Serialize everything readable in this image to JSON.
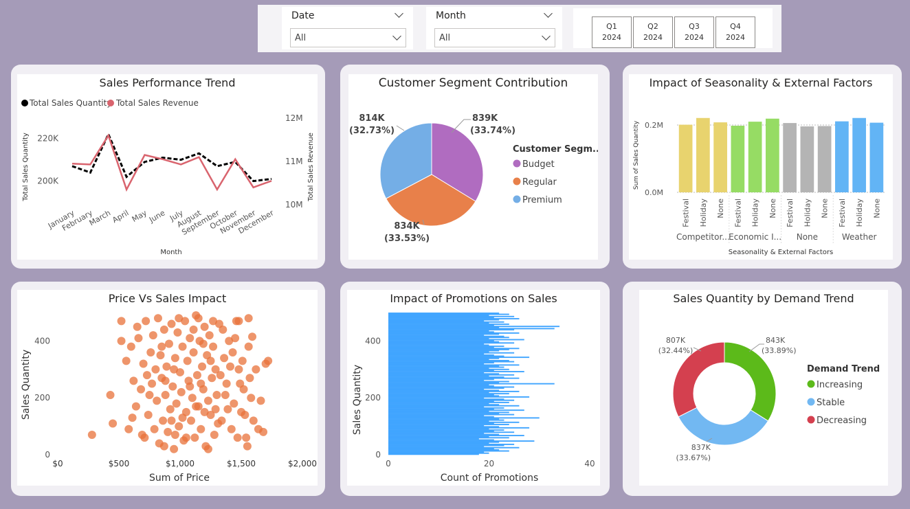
{
  "slicers": {
    "date": {
      "label": "Date",
      "value": "All"
    },
    "month": {
      "label": "Month",
      "value": "All"
    },
    "quarters": [
      {
        "q": "Q1",
        "year": "2024"
      },
      {
        "q": "Q2",
        "year": "2024"
      },
      {
        "q": "Q3",
        "year": "2024"
      },
      {
        "q": "Q4",
        "year": "2024"
      }
    ]
  },
  "colors": {
    "background": "#a59bb8",
    "line_quantity": "#000000",
    "line_revenue": "#d9646e",
    "budget": "#b06cc0",
    "regular": "#e8804a",
    "premium": "#74aee6",
    "scatter": "#e8723a",
    "bars": "#41a5ff",
    "increasing": "#5cba1a",
    "stable": "#72b8f2",
    "decreasing": "#d4404f",
    "seasonality_groups": [
      "#e8d36e",
      "#96dc64",
      "#b4b4b4",
      "#62b4f5"
    ]
  },
  "chart_data": [
    {
      "type": "line",
      "title": "Sales Performance Trend",
      "xlabel": "Month",
      "ylabel": "Total Sales Quantity",
      "y2label": "Total Sales Revenue",
      "legend": [
        "Total Sales Quantity",
        "Total Sales Revenue"
      ],
      "legend_position": "top-left",
      "categories": [
        "January",
        "February",
        "March",
        "April",
        "May",
        "June",
        "July",
        "August",
        "September",
        "October",
        "November",
        "December"
      ],
      "series": [
        {
          "name": "Total Sales Quantity",
          "axis": "left",
          "style": "dashed",
          "values": [
            207000,
            204000,
            222000,
            202000,
            209000,
            211000,
            210000,
            213000,
            207000,
            209000,
            200000,
            201000
          ]
        },
        {
          "name": "Total Sales Revenue",
          "axis": "right",
          "style": "solid",
          "values": [
            10950000,
            10930000,
            11600000,
            10350000,
            11150000,
            11050000,
            10930000,
            11100000,
            10350000,
            11050000,
            10400000,
            10550000
          ]
        }
      ],
      "y_ticks": [
        "200K",
        "220K"
      ],
      "y_tick_values": [
        200000,
        220000
      ],
      "ylim": [
        196000,
        226000
      ],
      "y2_ticks": [
        "10M",
        "11M",
        "12M"
      ],
      "y2_tick_values": [
        10000000,
        11000000,
        12000000
      ],
      "y2lim": [
        10000000,
        12000000
      ],
      "grid": false
    },
    {
      "type": "pie",
      "title": "Customer Segment Contribution",
      "legend_title": "Customer Segm...",
      "legend_position": "right",
      "slices": [
        {
          "name": "Budget",
          "value": 839000,
          "label": "839K",
          "pct": "(33.74%)"
        },
        {
          "name": "Regular",
          "value": 834000,
          "label": "834K",
          "pct": "(33.53%)"
        },
        {
          "name": "Premium",
          "value": 814000,
          "label": "814K",
          "pct": "(32.73%)"
        }
      ]
    },
    {
      "type": "bar",
      "title": "Impact of Seasonality & External Factors",
      "xlabel": "Seasonality & External Factors",
      "ylabel": "Sum of Sales Quantity",
      "y_ticks": [
        "0.0M",
        "0.2M"
      ],
      "y_tick_values": [
        0,
        200000
      ],
      "ylim": [
        0,
        245000
      ],
      "groups": [
        {
          "name": "Competitor...",
          "categories": [
            "Festival",
            "Holiday",
            "None"
          ],
          "values": [
            201000,
            221000,
            208000
          ]
        },
        {
          "name": "Economic I...",
          "categories": [
            "Festival",
            "Holiday",
            "None"
          ],
          "values": [
            198000,
            210000,
            219000
          ]
        },
        {
          "name": "None",
          "categories": [
            "Festival",
            "Holiday",
            "None"
          ],
          "values": [
            206000,
            196000,
            197000
          ]
        },
        {
          "name": "Weather",
          "categories": [
            "Festival",
            "Holiday",
            "None"
          ],
          "values": [
            211000,
            221000,
            207000
          ]
        }
      ],
      "grid": true
    },
    {
      "type": "scatter",
      "title": "Price Vs Sales Impact",
      "xlabel": "Sum of Price",
      "ylabel": "Sales Quantity",
      "x_ticks": [
        "$0",
        "$500",
        "$1,000",
        "$1,500",
        "$2,000"
      ],
      "x_tick_values": [
        0,
        500,
        1000,
        1500,
        2000
      ],
      "xlim": [
        0,
        2000
      ],
      "y_ticks": [
        "0",
        "200",
        "400"
      ],
      "y_tick_values": [
        0,
        200,
        400
      ],
      "ylim": [
        0,
        500
      ],
      "points": [
        [
          280,
          70
        ],
        [
          430,
          210
        ],
        [
          450,
          110
        ],
        [
          520,
          400
        ],
        [
          560,
          330
        ],
        [
          600,
          380
        ],
        [
          620,
          260
        ],
        [
          640,
          170
        ],
        [
          660,
          410
        ],
        [
          680,
          230
        ],
        [
          700,
          320
        ],
        [
          710,
          60
        ],
        [
          720,
          470
        ],
        [
          740,
          140
        ],
        [
          760,
          360
        ],
        [
          770,
          250
        ],
        [
          780,
          420
        ],
        [
          790,
          90
        ],
        [
          800,
          300
        ],
        [
          810,
          190
        ],
        [
          820,
          480
        ],
        [
          830,
          40
        ],
        [
          840,
          350
        ],
        [
          850,
          270
        ],
        [
          860,
          120
        ],
        [
          870,
          440
        ],
        [
          880,
          210
        ],
        [
          890,
          310
        ],
        [
          900,
          80
        ],
        [
          910,
          390
        ],
        [
          920,
          160
        ],
        [
          930,
          460
        ],
        [
          940,
          240
        ],
        [
          950,
          20
        ],
        [
          960,
          340
        ],
        [
          970,
          180
        ],
        [
          980,
          430
        ],
        [
          990,
          100
        ],
        [
          1000,
          290
        ],
        [
          1010,
          220
        ],
        [
          1020,
          380
        ],
        [
          1030,
          50
        ],
        [
          1040,
          470
        ],
        [
          1050,
          150
        ],
        [
          1060,
          330
        ],
        [
          1070,
          260
        ],
        [
          1080,
          410
        ],
        [
          1090,
          120
        ],
        [
          1100,
          200
        ],
        [
          1110,
          360
        ],
        [
          1120,
          60
        ],
        [
          1130,
          490
        ],
        [
          1140,
          280
        ],
        [
          1150,
          170
        ],
        [
          1160,
          400
        ],
        [
          1170,
          90
        ],
        [
          1180,
          310
        ],
        [
          1190,
          230
        ],
        [
          1200,
          450
        ],
        [
          1210,
          30
        ],
        [
          1220,
          350
        ],
        [
          1230,
          190
        ],
        [
          1240,
          420
        ],
        [
          1250,
          140
        ],
        [
          1260,
          270
        ],
        [
          1270,
          380
        ],
        [
          1280,
          70
        ],
        [
          1290,
          300
        ],
        [
          1300,
          210
        ],
        [
          1320,
          460
        ],
        [
          1340,
          120
        ],
        [
          1360,
          340
        ],
        [
          1380,
          250
        ],
        [
          1400,
          400
        ],
        [
          1420,
          90
        ],
        [
          1440,
          180
        ],
        [
          1460,
          470
        ],
        [
          1480,
          300
        ],
        [
          1500,
          150
        ],
        [
          1520,
          230
        ],
        [
          1540,
          60
        ],
        [
          1560,
          380
        ],
        [
          1580,
          200
        ],
        [
          1600,
          120
        ],
        [
          1620,
          300
        ],
        [
          1640,
          90
        ],
        [
          1660,
          190
        ],
        [
          1680,
          80
        ],
        [
          1700,
          320
        ],
        [
          1720,
          330
        ],
        [
          1560,
          480
        ],
        [
          1480,
          470
        ],
        [
          1590,
          415
        ],
        [
          520,
          470
        ],
        [
          580,
          90
        ],
        [
          650,
          450
        ],
        [
          690,
          70
        ],
        [
          730,
          280
        ],
        [
          870,
          30
        ],
        [
          930,
          120
        ],
        [
          990,
          480
        ],
        [
          1050,
          60
        ],
        [
          1110,
          440
        ],
        [
          1170,
          250
        ],
        [
          1230,
          20
        ],
        [
          1290,
          160
        ],
        [
          1350,
          440
        ],
        [
          1410,
          310
        ],
        [
          1470,
          60
        ],
        [
          1530,
          140
        ],
        [
          750,
          210
        ],
        [
          850,
          380
        ],
        [
          950,
          300
        ],
        [
          1020,
          130
        ],
        [
          1130,
          170
        ],
        [
          1190,
          390
        ],
        [
          1250,
          330
        ],
        [
          1310,
          110
        ],
        [
          1370,
          210
        ],
        [
          1430,
          360
        ],
        [
          1490,
          250
        ],
        [
          1550,
          30
        ],
        [
          610,
          130
        ],
        [
          880,
          260
        ],
        [
          960,
          70
        ],
        [
          1080,
          240
        ],
        [
          1150,
          480
        ],
        [
          1200,
          150
        ],
        [
          1270,
          470
        ],
        [
          1330,
          280
        ],
        [
          1390,
          160
        ],
        [
          1450,
          410
        ],
        [
          1510,
          330
        ],
        [
          1570,
          270
        ]
      ]
    },
    {
      "type": "bar",
      "orientation": "horizontal",
      "title": "Impact of Promotions on Sales",
      "xlabel": "Count of Promotions",
      "ylabel": "Sales Quantity",
      "x_ticks": [
        "0",
        "20",
        "40"
      ],
      "x_tick_values": [
        0,
        20,
        40
      ],
      "xlim": [
        0,
        40
      ],
      "y_ticks": [
        "0",
        "200",
        "400"
      ],
      "y_tick_values": [
        0,
        200,
        400
      ],
      "ylim": [
        0,
        500
      ],
      "values": [
        18,
        20,
        19,
        24,
        22,
        21,
        26,
        19,
        23,
        25,
        20,
        22,
        29,
        21,
        18,
        24,
        20,
        27,
        22,
        19,
        25,
        21,
        23,
        20,
        28,
        22,
        19,
        24,
        21,
        26,
        20,
        23,
        22,
        30,
        21,
        19,
        25,
        22,
        24,
        20,
        27,
        21,
        23,
        19,
        26,
        22,
        20,
        24,
        21,
        25,
        23,
        19,
        28,
        22,
        21,
        24,
        20,
        26,
        22,
        19,
        23,
        25,
        21,
        20,
        33,
        22,
        24,
        19,
        21,
        26,
        23,
        20,
        25,
        22,
        19,
        27,
        21,
        24,
        20,
        23,
        22,
        26,
        19,
        21,
        25,
        24,
        20,
        22,
        28,
        23,
        21,
        19,
        25,
        20,
        22,
        24,
        26,
        21,
        23,
        20,
        19,
        25,
        22,
        21,
        27,
        20,
        24,
        23,
        19,
        22,
        26,
        21,
        20,
        25,
        33,
        22,
        34,
        21,
        24,
        20,
        23,
        19,
        22,
        26,
        21,
        25,
        20,
        24,
        22
      ]
    },
    {
      "type": "pie",
      "variant": "donut",
      "title": "Sales Quantity by Demand Trend",
      "legend_title": "Demand Trend",
      "legend_position": "right",
      "slices": [
        {
          "name": "Increasing",
          "value": 843000,
          "label": "843K",
          "pct": "(33.89%)"
        },
        {
          "name": "Stable",
          "value": 837000,
          "label": "837K",
          "pct": "(33.67%)"
        },
        {
          "name": "Decreasing",
          "value": 807000,
          "label": "807K",
          "pct": "(32.44%)"
        }
      ]
    }
  ]
}
